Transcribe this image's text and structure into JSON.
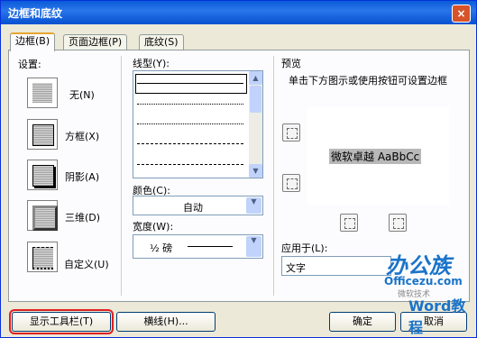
{
  "window": {
    "title": "边框和底纹",
    "close": "×"
  },
  "tabs": [
    {
      "label": "边框(B)"
    },
    {
      "label": "页面边框(P)"
    },
    {
      "label": "底纹(S)"
    }
  ],
  "settings": {
    "heading": "设置:",
    "items": [
      {
        "label": "无(N)"
      },
      {
        "label": "方框(X)"
      },
      {
        "label": "阴影(A)"
      },
      {
        "label": "三维(D)"
      },
      {
        "label": "自定义(U)"
      }
    ]
  },
  "style_list": {
    "label": "线型(Y):"
  },
  "color": {
    "label": "颜色(C):",
    "value": "自动"
  },
  "width": {
    "label": "宽度(W):",
    "value": "½ 磅"
  },
  "preview": {
    "heading": "预览",
    "hint": "单击下方图示或使用按钮可设置边框",
    "sample_text": "微软卓越  AaBbCc"
  },
  "apply_to": {
    "label": "应用于(L):",
    "value": "文字"
  },
  "buttons": {
    "toolbar": "显示工具栏(T)",
    "horizontal": "横线(H)...",
    "ok": "确定",
    "cancel": "取消"
  },
  "watermark": {
    "brand_cn": "办公族",
    "site": "Officezu.com",
    "sub": "微软技术",
    "course": "Word教程"
  }
}
